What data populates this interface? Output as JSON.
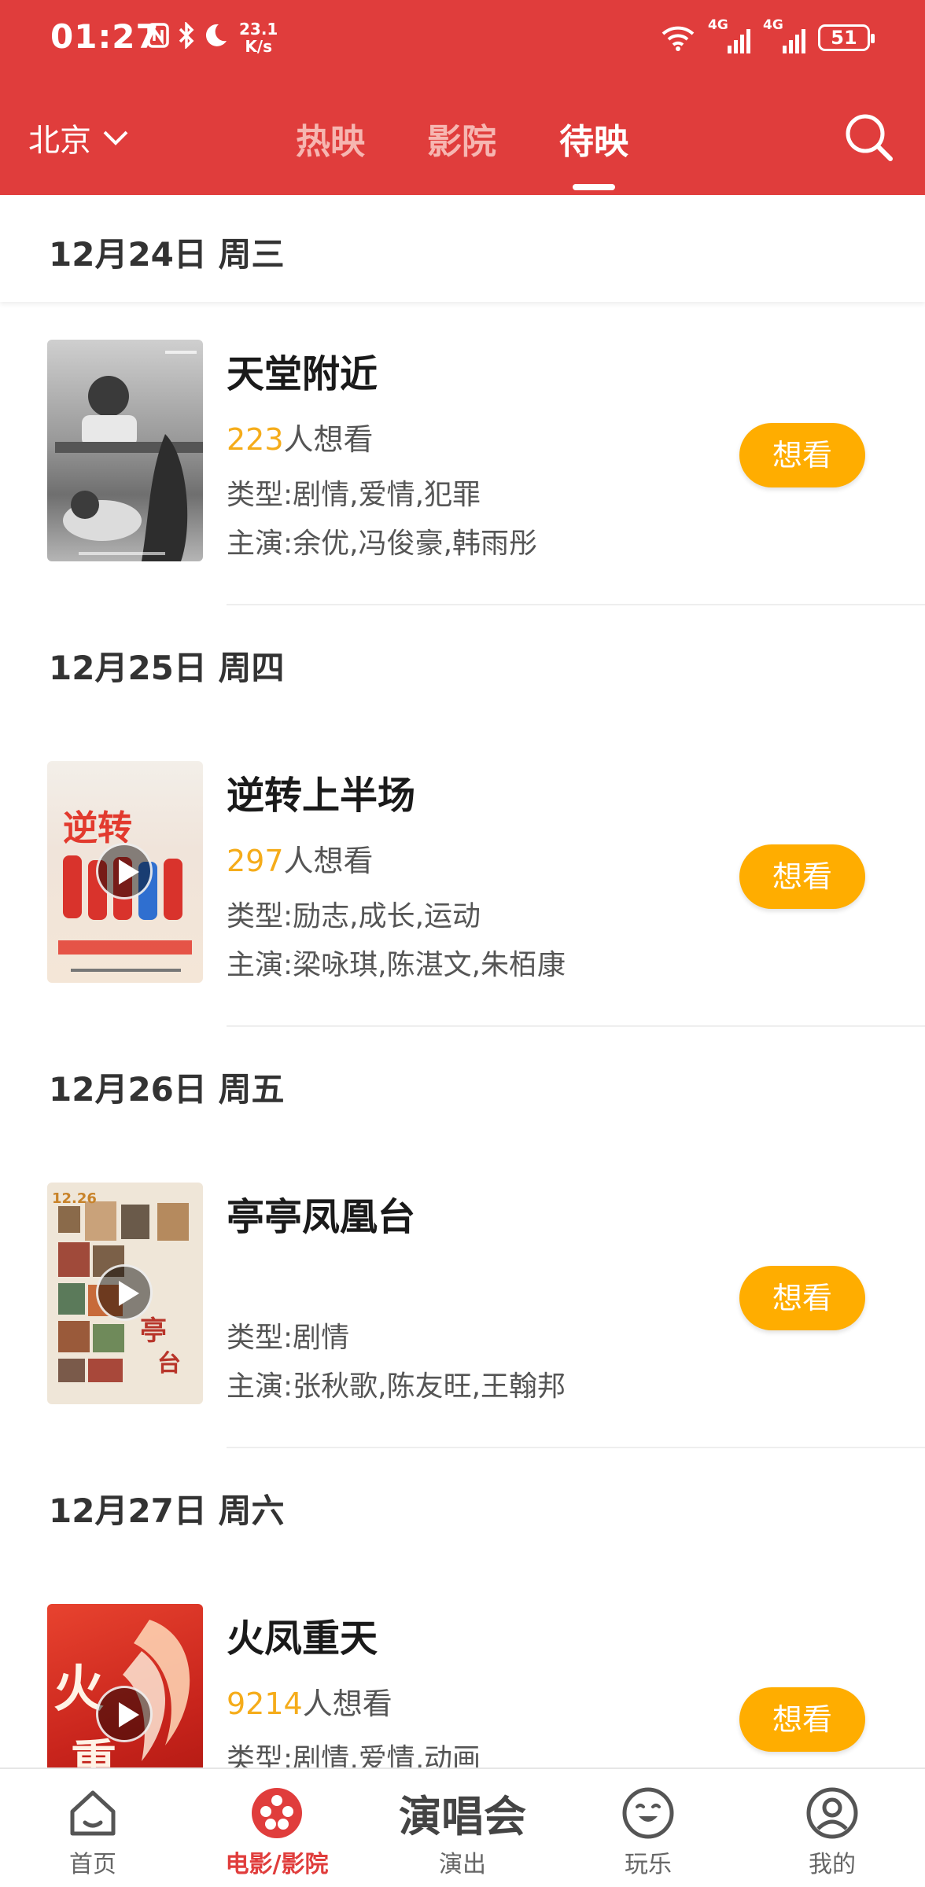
{
  "status_bar": {
    "time": "01:27",
    "icons": [
      "nfc-icon",
      "bluetooth-icon",
      "moon-icon"
    ],
    "net_speed_value": "23.1",
    "net_speed_unit": "K/s",
    "signal1_label": "4G",
    "signal2_label": "4G",
    "battery": "51"
  },
  "header": {
    "city": "北京",
    "tabs": [
      {
        "label": "热映",
        "active": false
      },
      {
        "label": "影院",
        "active": false
      },
      {
        "label": "待映",
        "active": true
      }
    ],
    "colors": {
      "primary": "#e03d3c",
      "inactive_tab": "#f6b6b1"
    }
  },
  "sticky_date": "12月24日 周三",
  "sections": [
    {
      "date": "12月24日 周三",
      "movie": {
        "title": "天堂附近",
        "want_count": "223",
        "want_suffix": "人想看",
        "genre": "类型:剧情,爱情,犯罪",
        "cast": "主演:余优,冯俊豪,韩雨彤",
        "button": "想看",
        "has_play": false
      }
    },
    {
      "date": "12月25日 周四",
      "movie": {
        "title": "逆转上半场",
        "want_count": "297",
        "want_suffix": "人想看",
        "genre": "类型:励志,成长,运动",
        "cast": "主演:梁咏琪,陈湛文,朱栢康",
        "button": "想看",
        "has_play": true
      }
    },
    {
      "date": "12月26日 周五",
      "movie": {
        "title": "亭亭凤凰台",
        "want_count": "",
        "want_suffix": "",
        "genre": "类型:剧情",
        "cast": "主演:张秋歌,陈友旺,王翰邦",
        "button": "想看",
        "has_play": true
      }
    },
    {
      "date": "12月27日 周六",
      "movie": {
        "title": "火凤重天",
        "want_count": "9214",
        "want_suffix": "人想看",
        "genre": "类型:剧情,爱情,动画",
        "cast": "",
        "button": "想看",
        "has_play": true
      }
    }
  ],
  "bottom_nav": [
    {
      "label": "首页",
      "icon": "home-icon",
      "active": false
    },
    {
      "label": "电影/影院",
      "icon": "film-reel-icon",
      "active": true
    },
    {
      "label": "演出",
      "icon_text": "演唱会",
      "active": false
    },
    {
      "label": "玩乐",
      "icon": "smiley-icon",
      "active": false
    },
    {
      "label": "我的",
      "icon": "user-icon",
      "active": false
    }
  ],
  "accent_colors": {
    "want_count": "#f5ac1a",
    "want_button": "#ffad00"
  }
}
